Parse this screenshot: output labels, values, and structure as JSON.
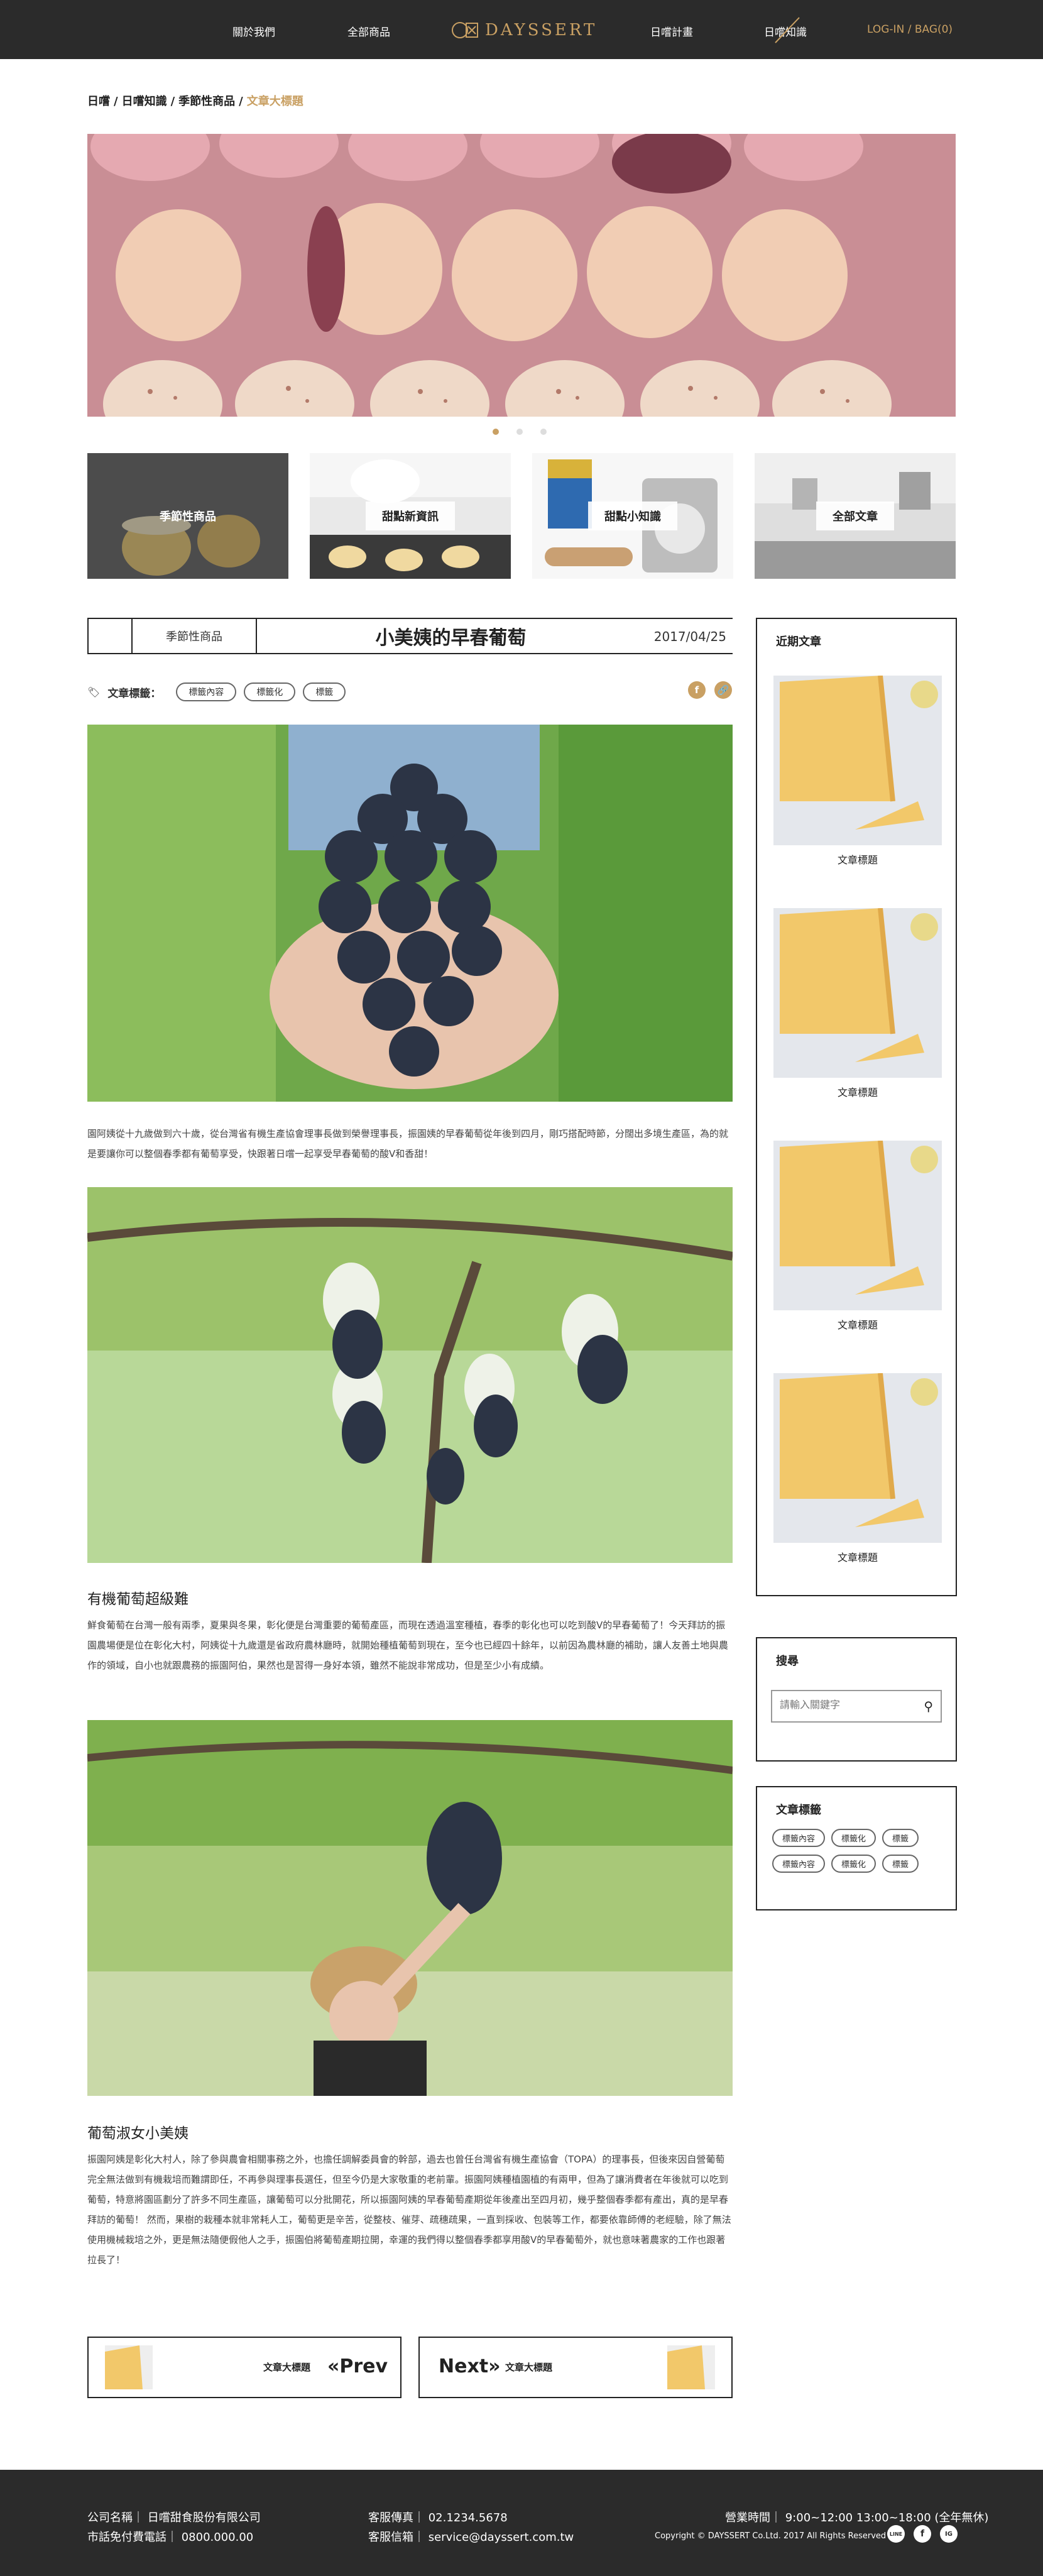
{
  "nav": {
    "items": [
      "關於我們",
      "全部商品",
      "日嚐計畫",
      "日嚐知識"
    ],
    "logo_text": "DAYSSERT",
    "login": "LOG-IN / BAG(0)"
  },
  "breadcrumb": {
    "items": [
      "日嚐",
      "日嚐知識",
      "季節性商品"
    ],
    "current": "文章大標題",
    "sep": "/"
  },
  "carousel": {
    "slides": 3,
    "active": 0
  },
  "categories": [
    "季節性商品",
    "甜點新資訊",
    "甜點小知識",
    "全部文章"
  ],
  "article": {
    "category": "季節性商品",
    "title": "小美姨的早春葡萄",
    "date": "2017/04/25",
    "tags_label": "文章標籤：",
    "tags": [
      "標籤內容",
      "標籤化",
      "標籤"
    ],
    "share_facebook": "f",
    "share_link": "🔗",
    "para1": "園阿姨從十九歲做到六十歲，從台灣省有機生產協會理事長做到榮譽理事長，振園姨的早春葡萄從年後到四月，剛巧搭配時節，分闊出多境生產區，為的就是要讓你可以整個春季都有葡萄享受，快跟著日嚐一起享受早春葡萄的酸V和香甜！",
    "subhead1": "有機葡萄超級難",
    "para2": "鮮食葡萄在台灣一般有兩季，夏果與冬果，彰化便是台灣重要的葡萄產區，而現在透過溫室種植，春季的彰化也可以吃到酸V的早春葡萄了！今天拜訪的振園農場便是位在彰化大村，阿姨從十九歲還是省政府農林廳時，就開始種植葡萄到現在，至今也已經四十餘年，以前因為農林廳的補助，讓人友善土地與農作的領域，自小也就跟農務的振園阿伯，果然也是習得一身好本領，雖然不能說非常成功，但是至少小有成績。",
    "subhead2": "葡萄淑女小美姨",
    "para3": "振園阿姨是彰化大村人，除了參與農會相關事務之外，也擔任調解委員會的幹部，過去也曾任台灣省有機生產協會（TOPA）的理事長，但後來因自營葡萄完全無法做到有機栽培而難謂即任，不再參與理事長選任，但至今仍是大家敬重的老前輩。振園阿姨種植園植的有兩甲，但為了讓消費者在年後就可以吃到葡萄，特意將園區劃分了許多不同生產區，讓葡萄可以分批開花，所以振園阿姨的早春葡萄產期從年後產出至四月初，幾乎整個春季都有產出，真的是早春拜訪的葡萄！ 然而，果樹的栽種本就非常耗人工，葡萄更是辛苦，從整枝、催芽、疏穗疏果，一直到採收、包裝等工作，都要依靠師傅的老經驗，除了無法使用機械栽培之外，更是無法隨便假他人之手，振園伯將葡萄產期拉開，幸運的我們得以整個春季都享用酸V的早春葡萄外，就也意味著農家的工作也跟著拉長了！"
  },
  "prev_next": {
    "prev_title": "文章大標題",
    "prev_label": "«Prev",
    "next_label": "Next»",
    "next_title": "文章大標題"
  },
  "sidebar": {
    "recent_title": "近期文章",
    "recent": [
      "文章標題",
      "文章標題",
      "文章標題",
      "文章標題"
    ],
    "search_title": "搜尋",
    "search_placeholder": "請輸入關鍵字",
    "tags_title": "文章標籤",
    "tags": [
      "標籤內容",
      "標籤化",
      "標籤",
      "標籤內容",
      "標籤化",
      "標籤"
    ]
  },
  "footer": {
    "company_label": "公司名稱",
    "company": "日嚐甜食股份有限公司",
    "toll_label": "市話免付費電話",
    "toll": "0800.000.00",
    "fax_label": "客服傳真",
    "fax": "02.1234.5678",
    "mail_label": "客服信箱",
    "mail": "service@dayssert.com.tw",
    "hours_label": "營業時間",
    "hours": "9:00~12:00 13:00~18:00 (全年無休)",
    "copyright": "Copyright © DAYSSERT Co.Ltd. 2017    All Rights Reserved",
    "social": [
      "LINE",
      "f",
      "IG"
    ]
  },
  "colors": {
    "accent": "#c9a063",
    "dark": "#2b2b2b"
  }
}
